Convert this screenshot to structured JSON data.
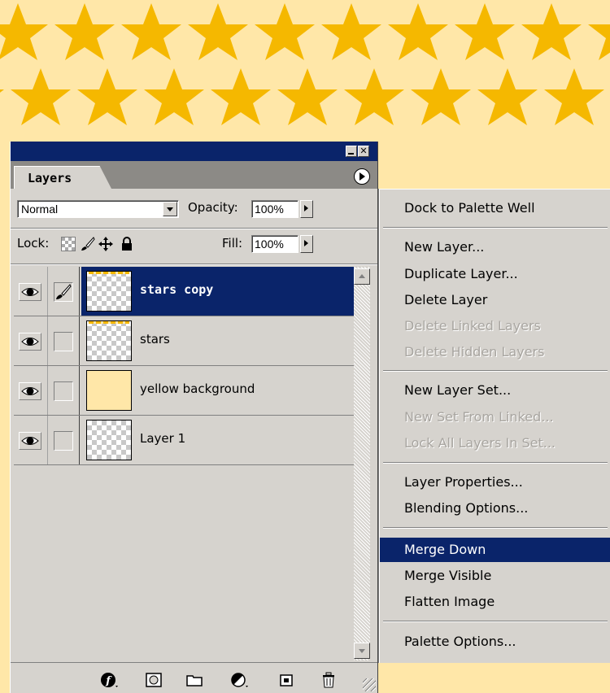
{
  "palette": {
    "tab_label": "Layers",
    "blend_mode": "Normal",
    "opacity_label": "Opacity:",
    "opacity_value": "100%",
    "lock_label": "Lock:",
    "fill_label": "Fill:",
    "fill_value": "100%",
    "layers": [
      {
        "name": "stars copy",
        "visible": true,
        "selected": true
      },
      {
        "name": "stars",
        "visible": true,
        "selected": false
      },
      {
        "name": "yellow background",
        "visible": true,
        "selected": false
      },
      {
        "name": "Layer 1",
        "visible": true,
        "selected": false
      }
    ]
  },
  "menu": {
    "items": [
      {
        "label": "Dock to Palette Well",
        "enabled": true
      },
      {
        "label": "New Layer...",
        "enabled": true
      },
      {
        "label": "Duplicate Layer...",
        "enabled": true
      },
      {
        "label": "Delete Layer",
        "enabled": true
      },
      {
        "label": "Delete Linked Layers",
        "enabled": false
      },
      {
        "label": "Delete Hidden Layers",
        "enabled": false
      },
      {
        "label": "New Layer Set...",
        "enabled": true
      },
      {
        "label": "New Set From Linked...",
        "enabled": false
      },
      {
        "label": "Lock All Layers In Set...",
        "enabled": false
      },
      {
        "label": "Layer Properties...",
        "enabled": true
      },
      {
        "label": "Blending Options...",
        "enabled": true
      },
      {
        "label": "Merge Down",
        "enabled": true,
        "highlighted": true
      },
      {
        "label": "Merge Visible",
        "enabled": true
      },
      {
        "label": "Flatten Image",
        "enabled": true
      },
      {
        "label": "Palette Options...",
        "enabled": true
      }
    ]
  },
  "colors": {
    "star": "#f5b800",
    "canvas_bg": "#ffe7a8",
    "selection": "#0a246a",
    "panel": "#d6d3ce"
  },
  "icons": {
    "canvas_pattern": "star-icon",
    "eye": "eye-icon",
    "brush": "brush-icon",
    "transparency_lock": "checkerboard-lock-icon",
    "move_lock": "move-icon",
    "padlock": "padlock-icon",
    "bottom_bar": [
      "layer-style-icon",
      "mask-icon",
      "folder-icon",
      "adjustment-layer-icon",
      "new-layer-icon",
      "trash-icon"
    ]
  }
}
